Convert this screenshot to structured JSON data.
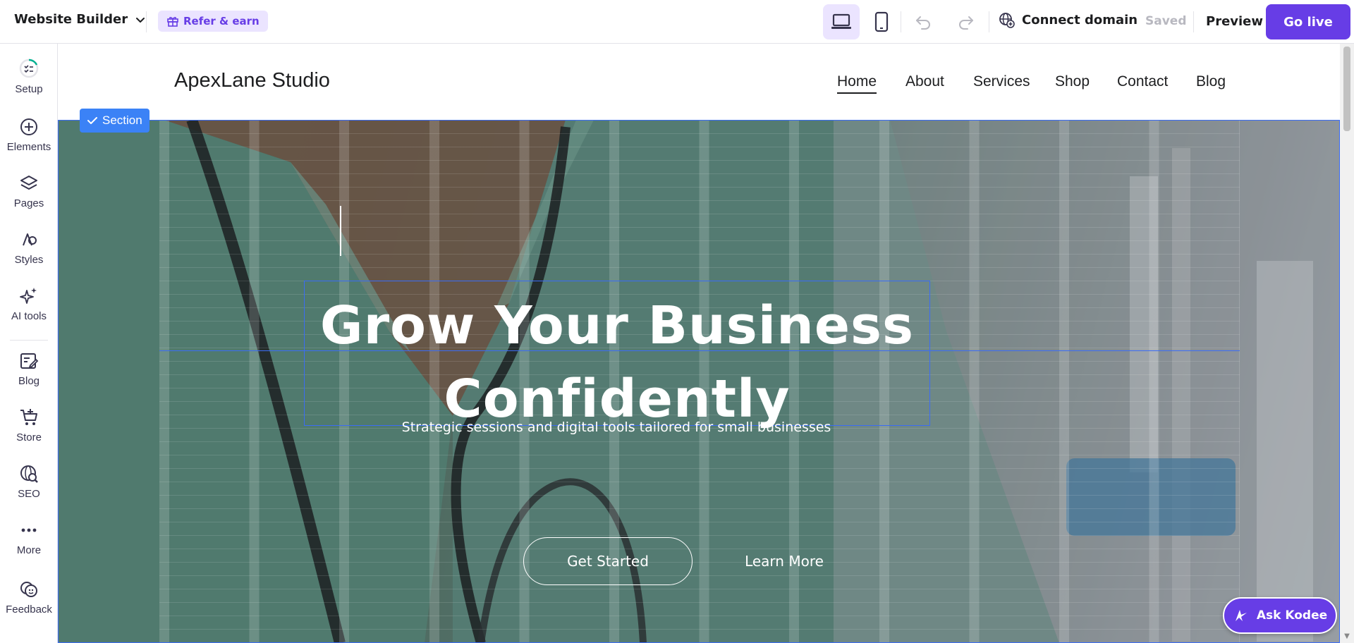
{
  "topbar": {
    "app_title": "Website Builder",
    "refer": "Refer & earn",
    "connect_domain": "Connect domain",
    "saved": "Saved",
    "preview": "Preview",
    "go_live": "Go live"
  },
  "sidebar": {
    "items": [
      {
        "label": "Setup",
        "icon": "setup-icon"
      },
      {
        "label": "Elements",
        "icon": "plus-circle-icon"
      },
      {
        "label": "Pages",
        "icon": "layers-icon"
      },
      {
        "label": "Styles",
        "icon": "palette-icon"
      },
      {
        "label": "AI tools",
        "icon": "sparkles-icon"
      },
      {
        "label": "Blog",
        "icon": "blog-edit-icon"
      },
      {
        "label": "Store",
        "icon": "cart-icon"
      },
      {
        "label": "SEO",
        "icon": "seo-globe-icon"
      },
      {
        "label": "More",
        "icon": "more-dots-icon"
      },
      {
        "label": "Feedback",
        "icon": "feedback-icon"
      }
    ]
  },
  "site": {
    "brand": "ApexLane Studio",
    "nav": [
      "Home",
      "About",
      "Services",
      "Shop",
      "Contact",
      "Blog"
    ],
    "active_nav": "Home"
  },
  "hero": {
    "section_tag": "Section",
    "title_line1": "Grow Your Business",
    "title_line2": "Confidently",
    "subtitle": "Strategic sessions and digital tools tailored for small businesses",
    "primary_button": "Get Started",
    "secondary_button": "Learn More"
  },
  "assistant": {
    "label": "Ask Kodee"
  },
  "colors": {
    "accent": "#673de6",
    "accent_light": "#ebe4ff",
    "selection": "#3b6cf6"
  }
}
